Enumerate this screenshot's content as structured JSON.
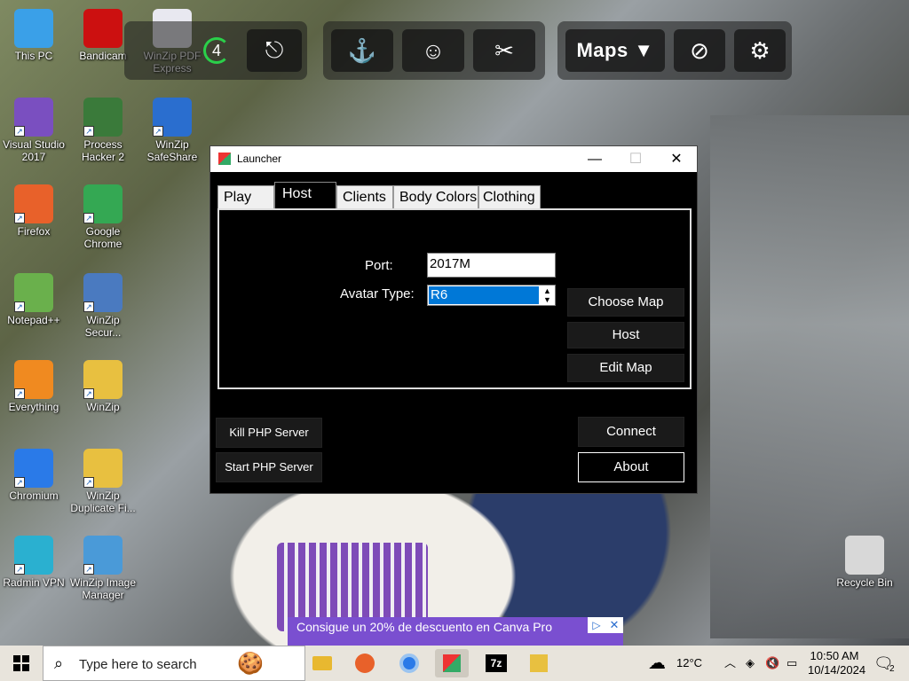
{
  "desktop": {
    "icons": [
      {
        "label": "This PC",
        "icon": "computer-icon",
        "color": "#3aa0e8"
      },
      {
        "label": "Bandicam",
        "icon": "bandicam-icon",
        "color": "#cc1010"
      },
      {
        "label": "WinZip PDF Express",
        "icon": "pdf-icon",
        "color": "#e8e8f0"
      },
      {
        "label": "Visual Studio 2017",
        "icon": "visual-studio-icon",
        "color": "#7a4fc0"
      },
      {
        "label": "Process Hacker 2",
        "icon": "process-hacker-icon",
        "color": "#3a7a3a"
      },
      {
        "label": "WinZip SafeShare",
        "icon": "share-icon",
        "color": "#2a6ecf"
      },
      {
        "label": "Firefox",
        "icon": "firefox-icon",
        "color": "#e8612a"
      },
      {
        "label": "Google Chrome",
        "icon": "chrome-icon",
        "color": "#34a853"
      },
      {
        "label": "Notepad++",
        "icon": "notepadpp-icon",
        "color": "#6ab04c"
      },
      {
        "label": "WinZip Secur...",
        "icon": "winzip-secure-icon",
        "color": "#4a7ac0"
      },
      {
        "label": "Everything",
        "icon": "everything-icon",
        "color": "#f08a20"
      },
      {
        "label": "WinZip",
        "icon": "winzip-icon",
        "color": "#e8c040"
      },
      {
        "label": "Chromium",
        "icon": "chromium-icon",
        "color": "#2a7ae8"
      },
      {
        "label": "WinZip Duplicate Fi...",
        "icon": "winzip-duplicate-icon",
        "color": "#e8c040"
      },
      {
        "label": "Radmin VPN",
        "icon": "radmin-vpn-icon",
        "color": "#2ab0d0"
      },
      {
        "label": "WinZip Image Manager",
        "icon": "winzip-image-icon",
        "color": "#4a9ad8"
      },
      {
        "label": "Recycle Bin",
        "icon": "recycle-bin-icon",
        "color": "#d8d8d8"
      }
    ]
  },
  "overlay_toolbar": {
    "counter": "4",
    "maps_label": "Maps ▼",
    "buttons": [
      "exit-icon",
      "spawn-icon",
      "avatar-icon",
      "tools-icon",
      "no-gravity-icon",
      "settings-icon"
    ]
  },
  "launcher": {
    "title": "Launcher",
    "tabs": [
      "Play",
      "Host",
      "Clients",
      "Body Colors",
      "Clothing"
    ],
    "active_tab": "Host",
    "port_label": "Port:",
    "port_value": "2017M",
    "avatar_label": "Avatar Type:",
    "avatar_value": "R6",
    "choose_map": "Choose Map",
    "host": "Host",
    "edit_map": "Edit Map",
    "kill_php": "Kill PHP Server",
    "start_php": "Start PHP Server",
    "connect": "Connect",
    "about": "About"
  },
  "ad": {
    "text": "Consigue un 20% de descuento en Canva Pro"
  },
  "taskbar": {
    "search_placeholder": "Type here to search",
    "weather": "12°C",
    "time": "10:50 AM",
    "date": "10/14/2024",
    "notification_count": "2"
  }
}
